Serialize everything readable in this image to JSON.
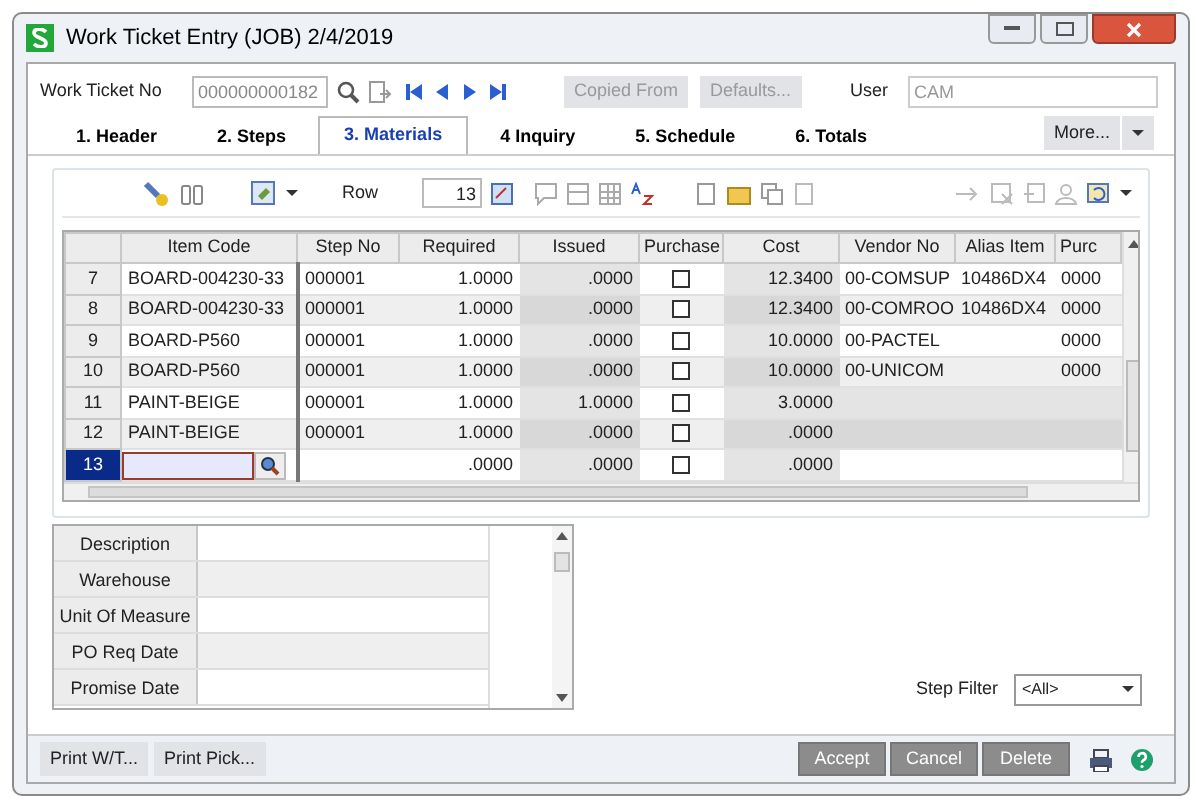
{
  "window": {
    "title": "Work Ticket Entry (JOB) 2/4/2019"
  },
  "header": {
    "ticket_label": "Work Ticket No",
    "ticket_value": "000000000182",
    "copied_from": "Copied From",
    "defaults": "Defaults...",
    "user_label": "User",
    "user_value": "CAM",
    "more": "More..."
  },
  "tabs": [
    {
      "label": "1. Header",
      "selected": false
    },
    {
      "label": "2. Steps",
      "selected": false
    },
    {
      "label": "3. Materials",
      "selected": true
    },
    {
      "label": "4 Inquiry",
      "selected": false
    },
    {
      "label": "5. Schedule",
      "selected": false
    },
    {
      "label": "6. Totals",
      "selected": false
    }
  ],
  "row_box": {
    "label": "Row",
    "value": "13"
  },
  "table": {
    "columns": [
      "Item Code",
      "Step No",
      "Required",
      "Issued",
      "Purchase",
      "Cost",
      "Vendor No",
      "Alias Item",
      "Purc"
    ],
    "rows": [
      {
        "num": "7",
        "item": "BOARD-004230-33",
        "step": "000001",
        "required": "1.0000",
        "issued": ".0000",
        "purchase": false,
        "cost": "12.3400",
        "vendor": "00-COMSUP",
        "alias": "10486DX4",
        "purc": "0000",
        "selected": false
      },
      {
        "num": "8",
        "item": "BOARD-004230-33",
        "step": "000001",
        "required": "1.0000",
        "issued": ".0000",
        "purchase": false,
        "cost": "12.3400",
        "vendor": "00-COMROO",
        "alias": "10486DX4",
        "purc": "0000",
        "selected": false
      },
      {
        "num": "9",
        "item": "BOARD-P560",
        "step": "000001",
        "required": "1.0000",
        "issued": ".0000",
        "purchase": false,
        "cost": "10.0000",
        "vendor": "00-PACTEL",
        "alias": "",
        "purc": "0000",
        "selected": false
      },
      {
        "num": "10",
        "item": "BOARD-P560",
        "step": "000001",
        "required": "1.0000",
        "issued": ".0000",
        "purchase": false,
        "cost": "10.0000",
        "vendor": "00-UNICOM",
        "alias": "",
        "purc": "0000",
        "selected": false
      },
      {
        "num": "11",
        "item": "PAINT-BEIGE",
        "step": "000001",
        "required": "1.0000",
        "issued": "1.0000",
        "purchase": false,
        "cost": "3.0000",
        "vendor": "",
        "alias": "",
        "purc": "",
        "selected": false
      },
      {
        "num": "12",
        "item": "PAINT-BEIGE",
        "step": "000001",
        "required": "1.0000",
        "issued": ".0000",
        "purchase": false,
        "cost": ".0000",
        "vendor": "",
        "alias": "",
        "purc": "",
        "selected": false
      },
      {
        "num": "13",
        "item": "",
        "step": "",
        "required": ".0000",
        "issued": ".0000",
        "purchase": false,
        "cost": ".0000",
        "vendor": "",
        "alias": "",
        "purc": "",
        "selected": true
      }
    ]
  },
  "details": [
    "Description",
    "Warehouse",
    "Unit Of Measure",
    "PO Req Date",
    "Promise Date"
  ],
  "step_filter": {
    "label": "Step Filter",
    "value": "<All>"
  },
  "buttons_left": [
    "Print W/T...",
    "Print Pick..."
  ],
  "buttons_right": [
    "Accept",
    "Cancel",
    "Delete"
  ]
}
